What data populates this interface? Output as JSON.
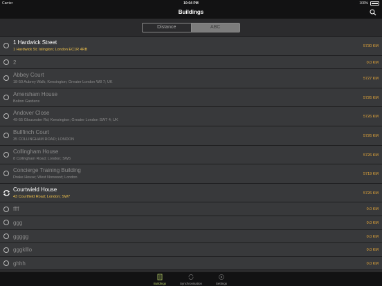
{
  "status_bar": {
    "carrier": "Carrier",
    "time": "10:04 PM",
    "battery": "100%"
  },
  "nav": {
    "title": "Buildings"
  },
  "segments": [
    {
      "label": "Distance",
      "selected": false
    },
    {
      "label": "ABC",
      "selected": true
    }
  ],
  "buildings": [
    {
      "name": "1 Hardwick Street",
      "address": "1 Hardwick St; Islington; London EC1R 4RB",
      "distance": "5730 KM",
      "active": true,
      "sync": false
    },
    {
      "name": "2",
      "address": "",
      "distance": "0.0 KM",
      "active": false,
      "sync": false
    },
    {
      "name": "Abbey Court",
      "address": "18-50 Aubrey Walk; Kensington; Greater London W8 7; UK",
      "distance": "5727 KM",
      "active": false,
      "sync": false
    },
    {
      "name": "Amersham House",
      "address": "Bolton Gardens",
      "distance": "5726 KM",
      "active": false,
      "sync": false
    },
    {
      "name": "Andover Close",
      "address": "49-55 Gloucester Rd; Kensington; Greater London SW7 4; UK",
      "distance": "5726 KM",
      "active": false,
      "sync": false
    },
    {
      "name": "Bullfinch Court",
      "address": "35 COLLINGHAM ROAD; LONDON",
      "distance": "5726 KM",
      "active": false,
      "sync": false
    },
    {
      "name": "Collingham House",
      "address": "8 Collingham Road; London; SW5",
      "distance": "5726 KM",
      "active": false,
      "sync": false
    },
    {
      "name": "Concierge Training Building",
      "address": "Drake House; West Norwood; London",
      "distance": "5719 KM",
      "active": false,
      "sync": false
    },
    {
      "name": "Courtwield House",
      "address": "43 Courtfield Road; London; SW7",
      "distance": "5726 KM",
      "active": true,
      "sync": true
    },
    {
      "name": "ffff",
      "address": "",
      "distance": "0.0 KM",
      "active": false,
      "sync": false
    },
    {
      "name": "ggg",
      "address": "",
      "distance": "0.0 KM",
      "active": false,
      "sync": false
    },
    {
      "name": "ggggg",
      "address": "",
      "distance": "0.0 KM",
      "active": false,
      "sync": false
    },
    {
      "name": "gggklllo",
      "address": "",
      "distance": "0.0 KM",
      "active": false,
      "sync": false
    },
    {
      "name": "ghhh",
      "address": "",
      "distance": "0.0 KM",
      "active": false,
      "sync": false
    }
  ],
  "tabs": [
    {
      "label": "Buildings",
      "icon": "buildings-icon",
      "active": true
    },
    {
      "label": "Synchronisation",
      "icon": "sync-icon",
      "active": false
    },
    {
      "label": "Settings",
      "icon": "gear-icon",
      "active": false
    }
  ],
  "colors": {
    "accent": "#b9d36a",
    "distance": "#e8a93a",
    "active_address": "#f0c24b"
  }
}
